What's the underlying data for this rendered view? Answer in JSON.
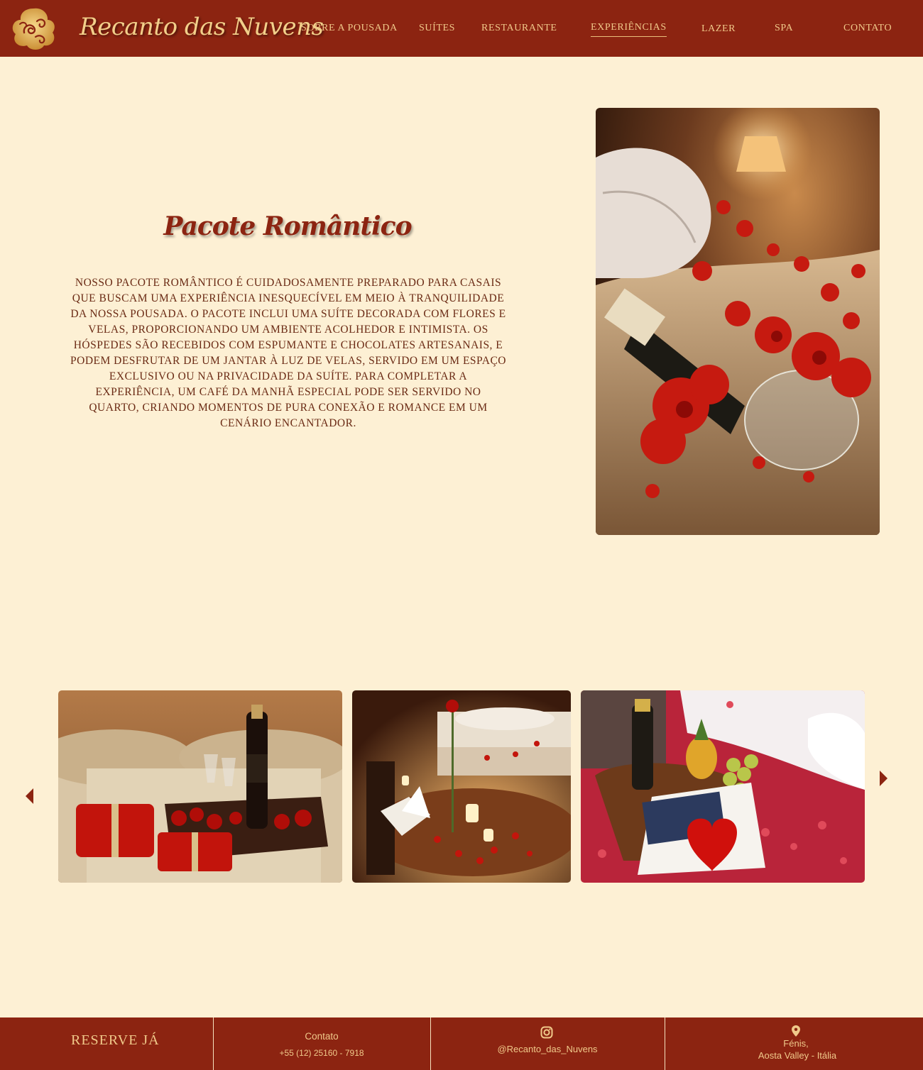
{
  "header": {
    "brand": "Recanto das Nuvens",
    "nav": [
      {
        "label": "Sobre a Pousada"
      },
      {
        "label": "Suítes"
      },
      {
        "label": "Restaurante"
      },
      {
        "label": "Experiências",
        "active": true
      },
      {
        "label": "Lazer"
      },
      {
        "label": "SPA"
      },
      {
        "label": "Contato"
      }
    ]
  },
  "main": {
    "title": "Pacote Romântico",
    "description": "Nosso pacote romântico é cuidadosamente preparado para casais que buscam uma experiência inesquecível em meio à tranquilidade da nossa pousada. O pacote inclui uma suíte decorada com flores e velas, proporcionando um ambiente acolhedor e intimista. Os hóspedes são recebidos com espumante e chocolates artesanais, e podem desfrutar de um jantar à luz de velas, servido em um espaço exclusivo ou na privacidade da suíte. Para completar a experiência, um café da manhã especial pode ser servido no quarto, criando momentos de pura conexão e romance em um cenário encantador."
  },
  "carousel": {
    "prev_icon": "arrow-left-icon",
    "next_icon": "arrow-right-icon"
  },
  "footer": {
    "reserve": "RESERVE JÁ",
    "contact_title": "Contato",
    "phone": "+55 (12) 25160 - 7918",
    "instagram": "@Recanto_das_Nuvens",
    "location_line1": "Fénis,",
    "location_line2": "Aosta Valley -  Itália"
  },
  "colors": {
    "primary": "#8c2411",
    "gold": "#f0c98a",
    "background": "#fdf0d4"
  }
}
